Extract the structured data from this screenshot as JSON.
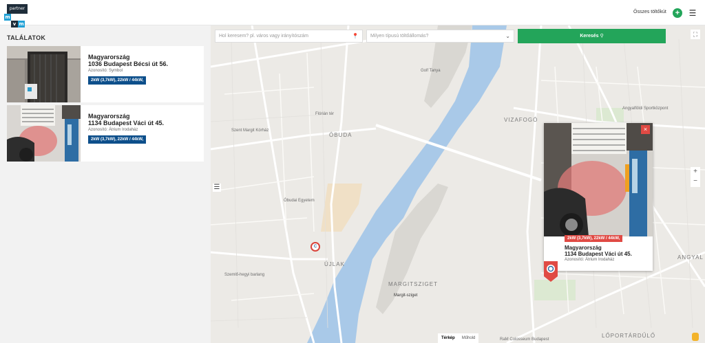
{
  "header": {
    "logo_text": "partner",
    "logo_letters": [
      "m",
      "v",
      "m"
    ],
    "all_chargers_link": "Összes töltőkút",
    "add_icon": "plus-icon",
    "menu_icon": "hamburger-icon"
  },
  "sidebar": {
    "title": "TALÁLATOK",
    "results": [
      {
        "country": "Magyarország",
        "address": "1036 Budapest Bécsi út 56.",
        "id_line": "Azonosító: Symbol",
        "power": "2kW (3,7kW), 22kW / 44kW,"
      },
      {
        "country": "Magyarország",
        "address": "1134 Budapest Váci út 45.",
        "id_line": "Azonosító: Átrium Irodaház",
        "power": "2kW (3,7kW), 22kW / 44kW,"
      }
    ]
  },
  "search": {
    "location_placeholder": "Hol keresem? pl. város vagy irányítószám",
    "type_placeholder": "Milyen típusú töltőállomás?",
    "button_label": "Keresés"
  },
  "map": {
    "labels": {
      "obuda": "ÓBUDA",
      "ujlak": "ÚJLAK",
      "vizafogo": "VIZAFOGÓ",
      "margitsziget": "MARGITSZIGET",
      "margit_sziget": "Margit-sziget",
      "angyal": "ANGYAL",
      "loportardombo": "LŐPORTÁRDŰLŐ",
      "golf": "Golf Tanya",
      "floriantér": "Flórián tér",
      "szemlohegyi": "Szemlő-hegyi barlang",
      "obudai_egyetem": "Óbudai Egyetem",
      "szent_margit": "Szent Margit Kórház",
      "angyalfoldi": "Angyalföldi Sportközpont",
      "colosseum": "RaM Colosseum Budapest"
    },
    "maptype": {
      "map": "Térkép",
      "satellite": "Műhold"
    },
    "colors": {
      "water": "#a9c9e8",
      "land": "#eceae6",
      "road": "#ffffff",
      "marker": "#d9433b"
    }
  },
  "popup": {
    "power": "2kW (3,7kW), 22kW / 44kW,",
    "country": "Magyarország",
    "address": "1134 Budapest Váci út 45.",
    "id_line": "Azonosító: Átrium Irodaház"
  }
}
